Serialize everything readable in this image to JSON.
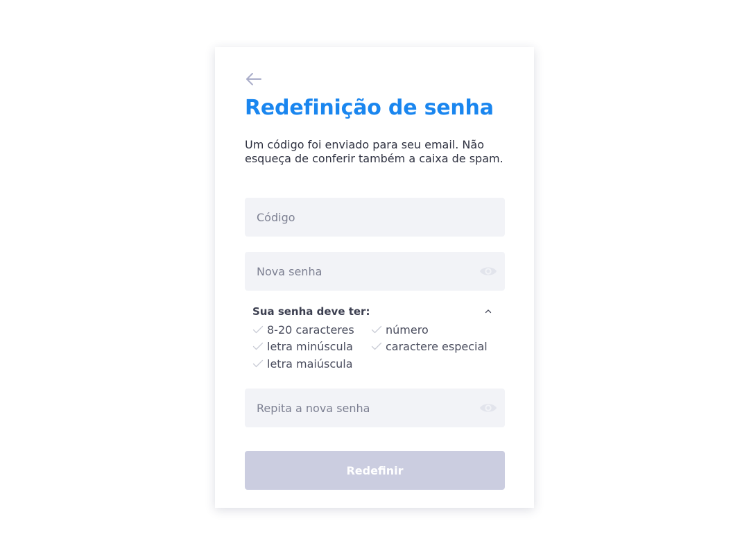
{
  "form": {
    "title": "Redefinição de senha",
    "description": "Um código foi enviado para seu email. Não esqueça de conferir também a caixa de spam.",
    "code_placeholder": "Código",
    "new_password_placeholder": "Nova senha",
    "repeat_password_placeholder": "Repita a nova senha",
    "submit_label": "Redefinir",
    "submit_enabled": false
  },
  "requirements": {
    "title": "Sua senha deve ter:",
    "expanded": true,
    "items": [
      {
        "label": "8-20 caracteres",
        "met": false
      },
      {
        "label": "número",
        "met": false
      },
      {
        "label": "letra minúscula",
        "met": false
      },
      {
        "label": "caractere especial",
        "met": false
      },
      {
        "label": "letra maiúscula",
        "met": false
      }
    ]
  },
  "icons": {
    "back": "arrow-left-icon",
    "password_visibility": "eye-icon",
    "collapse": "chevron-up-icon",
    "requirement": "check-icon"
  },
  "colors": {
    "accent": "#1a86ef",
    "field_background": "#f2f3f7",
    "button_disabled": "#cbcde0",
    "text": "#2e3140",
    "check_unmet": "#c9cbd6"
  }
}
